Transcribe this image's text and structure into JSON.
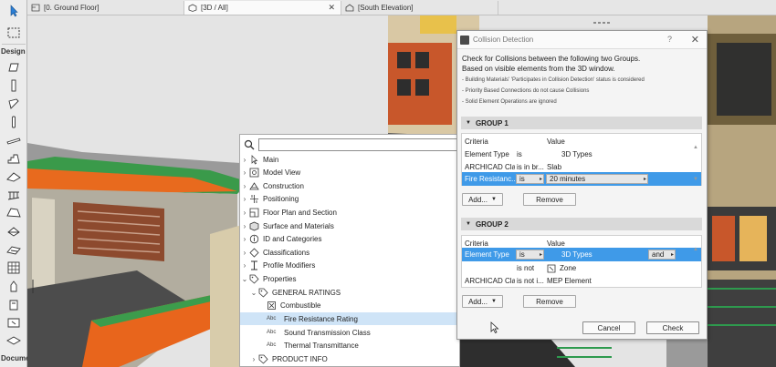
{
  "toolbox": {
    "label_design": "Design",
    "label_document": "Docume"
  },
  "tabs": [
    {
      "label": "[0. Ground Floor]"
    },
    {
      "label": "[3D / All]"
    },
    {
      "label": "[South Elevation]"
    }
  ],
  "tree": {
    "search_value": "",
    "items": [
      {
        "label": "Main",
        "icon": "cursor-icon",
        "expanded": false
      },
      {
        "label": "Model View",
        "icon": "model-view-icon",
        "expanded": false
      },
      {
        "label": "Construction",
        "icon": "construction-icon",
        "expanded": false
      },
      {
        "label": "Positioning",
        "icon": "positioning-icon",
        "expanded": false
      },
      {
        "label": "Floor Plan and Section",
        "icon": "floor-plan-icon",
        "expanded": false
      },
      {
        "label": "Surface and Materials",
        "icon": "surface-icon",
        "expanded": false
      },
      {
        "label": "ID and Categories",
        "icon": "id-icon",
        "expanded": false
      },
      {
        "label": "Classifications",
        "icon": "classification-icon",
        "expanded": false
      },
      {
        "label": "Profile Modifiers",
        "icon": "profile-icon",
        "expanded": false
      },
      {
        "label": "Properties",
        "icon": "tag-icon",
        "expanded": true
      },
      {
        "label": "GENERAL RATINGS",
        "icon": "tag-icon",
        "expanded": true
      },
      {
        "label": "Combustible",
        "icon": "checkbox-icon"
      },
      {
        "label": "Fire Resistance Rating",
        "icon": "abc-icon",
        "selected": true
      },
      {
        "label": "Sound Transmission Class",
        "icon": "abc-icon"
      },
      {
        "label": "Thermal Transmittance",
        "icon": "abc-icon"
      },
      {
        "label": "PRODUCT INFO",
        "icon": "tag-icon",
        "expanded": false
      }
    ],
    "abc": "Abc"
  },
  "dialog": {
    "title": "Collision Detection",
    "help": "?",
    "close": "✕",
    "intro_1": "Check for Collisions between the following two Groups.",
    "intro_2": "Based on visible elements from the 3D window.",
    "notes": [
      "- Building Materials' 'Participates in Collision Detection' status is considered",
      "- Priority Based Connections do not cause Collisions",
      "- Solid Element Operations are ignored"
    ],
    "group1": {
      "title": "GROUP 1",
      "col_criteria": "Criteria",
      "col_value": "Value",
      "rows": [
        {
          "criteria": "Element Type",
          "op": "is",
          "value": "3D Types"
        },
        {
          "criteria": "ARCHICAD Cla...",
          "op": "is in br...",
          "value": "Slab"
        },
        {
          "criteria": "Fire Resistanc...",
          "op": "is",
          "value": "20 minutes",
          "selected": true
        }
      ],
      "add": "Add...",
      "remove": "Remove"
    },
    "group2": {
      "title": "GROUP 2",
      "col_criteria": "Criteria",
      "col_value": "Value",
      "rows": [
        {
          "criteria": "Element Type",
          "op": "is",
          "value": "3D Types",
          "logic": "and",
          "selected": true
        },
        {
          "criteria": "",
          "op": "is not",
          "value": "Zone"
        },
        {
          "criteria": "ARCHICAD Cla...",
          "op": "is not i...",
          "value": "MEP Element"
        }
      ],
      "add": "Add...",
      "remove": "Remove"
    },
    "cancel": "Cancel",
    "check": "Check"
  }
}
